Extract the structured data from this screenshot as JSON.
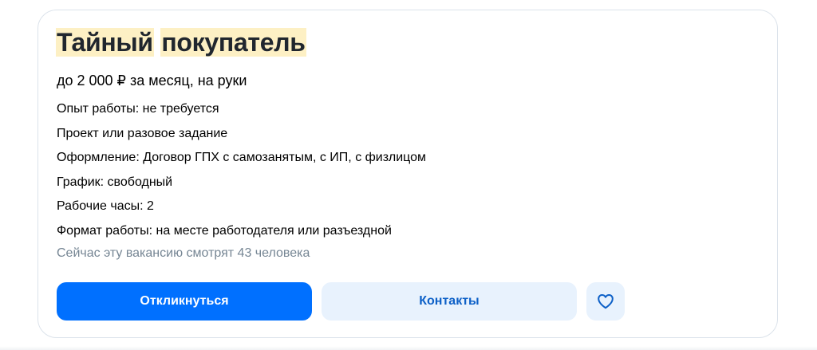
{
  "vacancy": {
    "title_word_1": "Тайный",
    "title_word_2": "покупатель",
    "salary": "до 2 000 ₽ за месяц, на руки",
    "facts": [
      "Опыт работы: не требуется",
      "Проект или разовое задание",
      "Оформление: Договор ГПХ с самозанятым, с ИП, с физлицом",
      "График: свободный",
      "Рабочие часы: 2",
      "Формат работы: на месте работодателя или разъездной"
    ],
    "viewers_text": "Сейчас эту вакансию смотрят 43 человека"
  },
  "actions": {
    "respond_label": "Откликнуться",
    "contacts_label": "Контакты",
    "favorite_icon": "heart-icon"
  },
  "colors": {
    "title_highlight": "#fdf0c4",
    "primary_button": "#0070ff",
    "secondary_button": "#e8f2fd",
    "secondary_text": "#0d60c7",
    "muted_text": "#768694"
  }
}
